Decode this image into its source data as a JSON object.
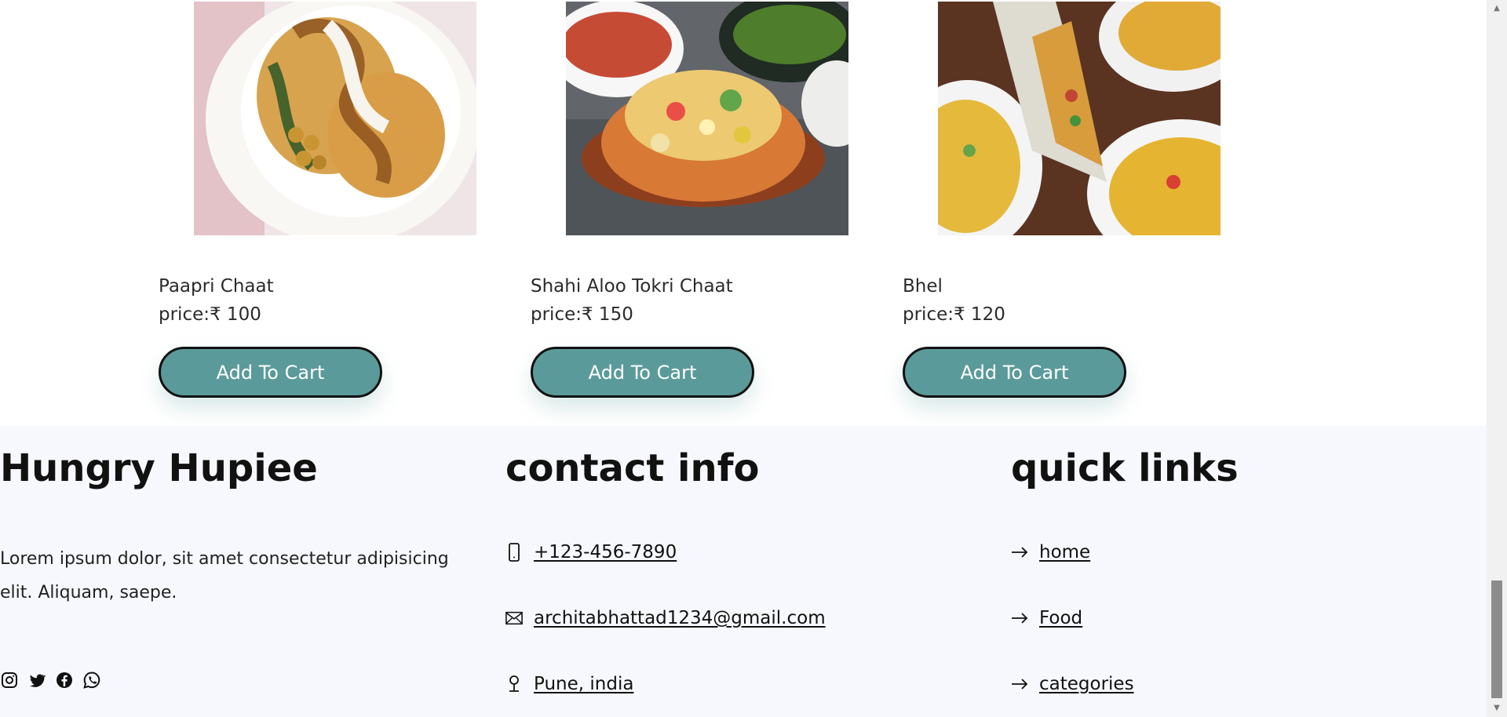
{
  "products": [
    {
      "name": "Paapri Chaat",
      "price": "price:₹ 100",
      "button": "Add To Cart"
    },
    {
      "name": "Shahi Aloo Tokri Chaat",
      "price": "price:₹ 150",
      "button": "Add To Cart"
    },
    {
      "name": "Bhel",
      "price": "price:₹ 120",
      "button": "Add To Cart"
    }
  ],
  "footer": {
    "brand": {
      "title": "Hungry Hupiee",
      "text": "Lorem ipsum dolor, sit amet consectetur adipisicing elit. Aliquam, saepe.",
      "social_icons": [
        "instagram-icon",
        "twitter-icon",
        "facebook-icon",
        "whatsapp-icon"
      ]
    },
    "contact": {
      "title": "contact info",
      "phone": " +123-456-7890",
      "email": " architabhattad1234@gmail.com",
      "location": " Pune, india"
    },
    "quick_links": {
      "title": "quick links",
      "links": [
        " home",
        " Food",
        " categories"
      ]
    }
  },
  "colors": {
    "button": "#5b9a9b",
    "footer_bg": "#f7f8fd"
  }
}
